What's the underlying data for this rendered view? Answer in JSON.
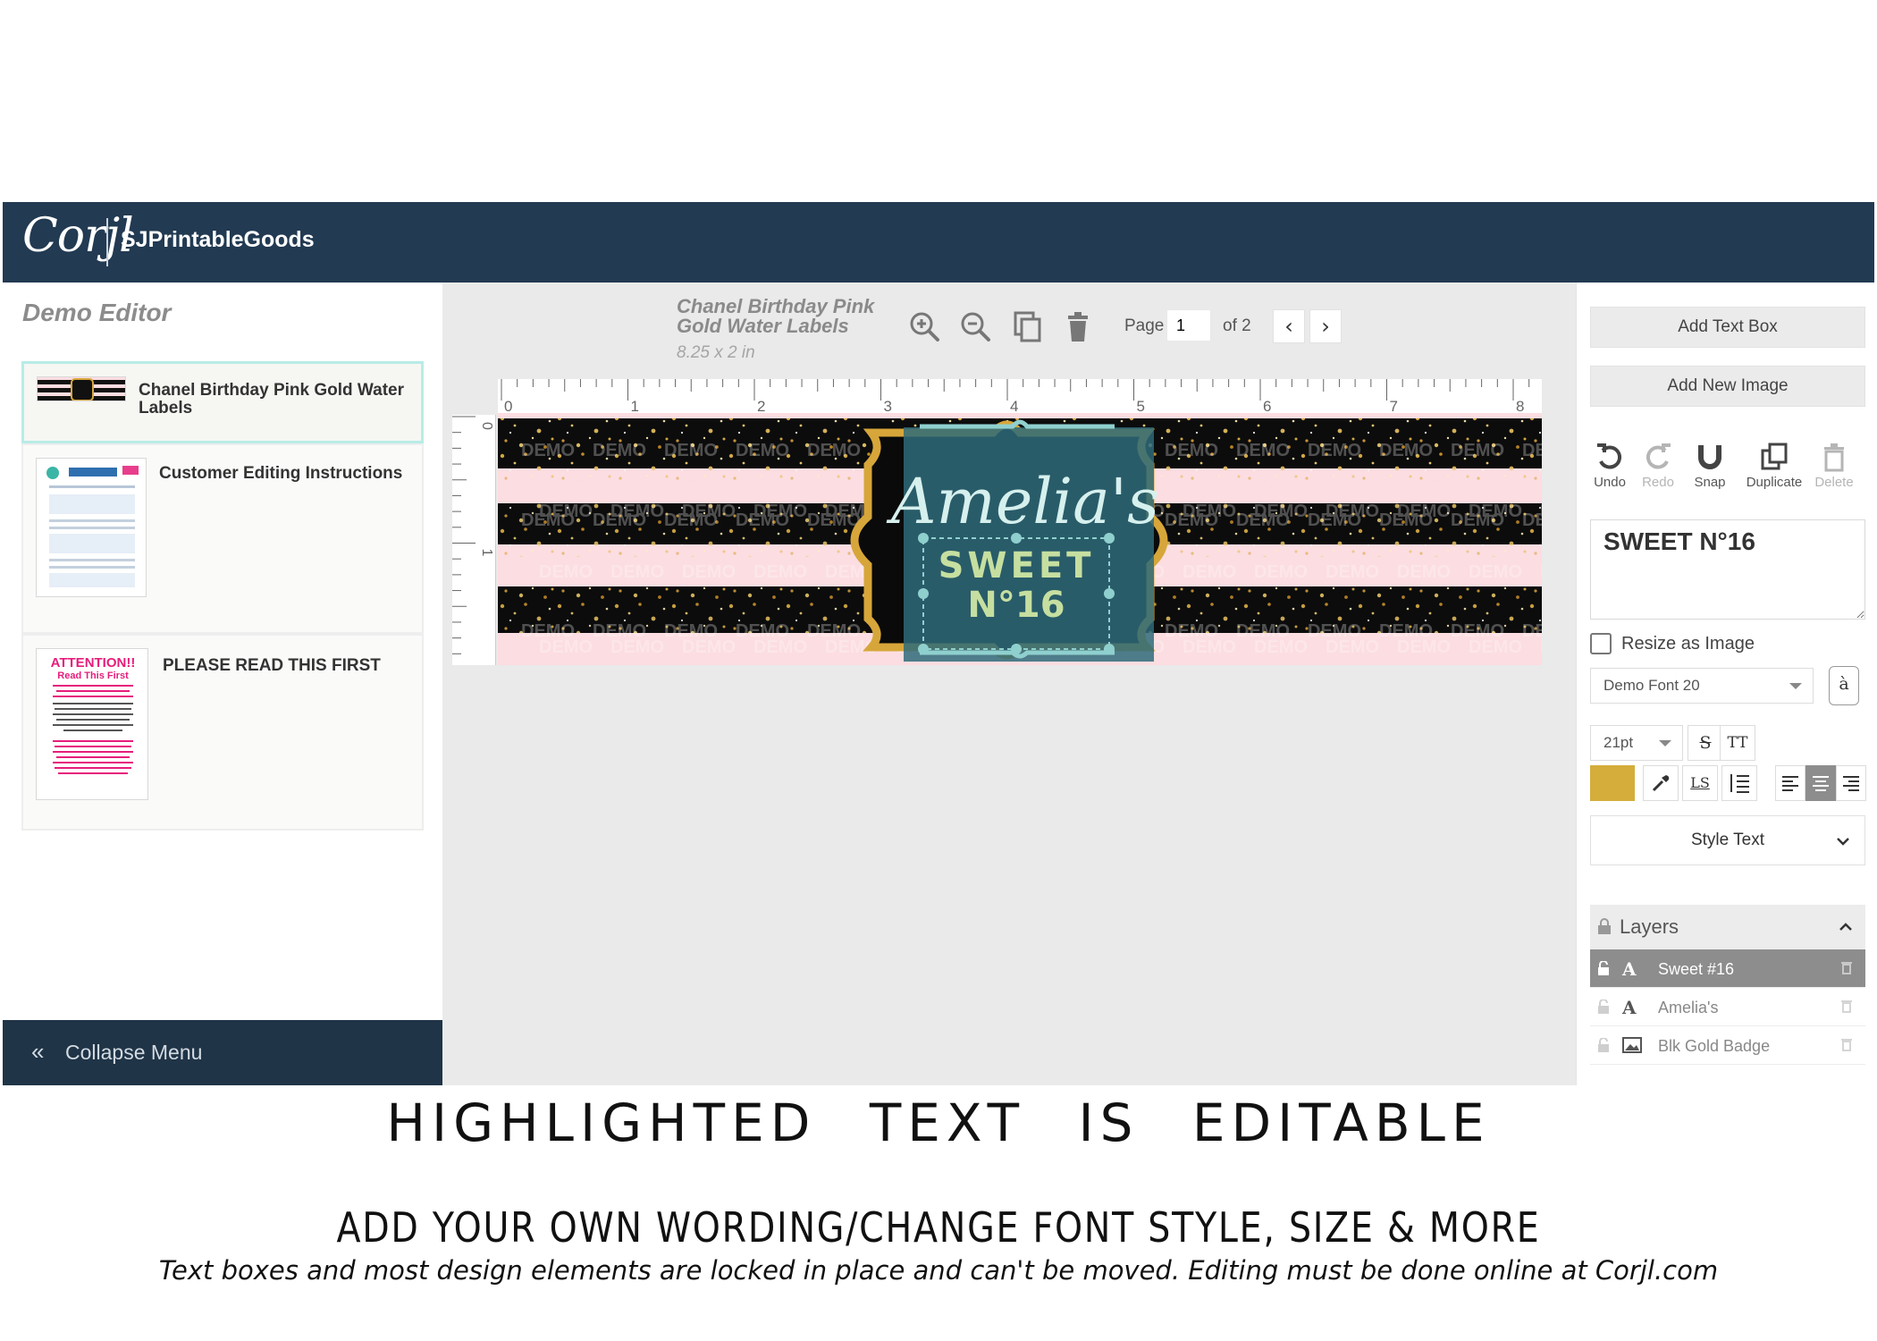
{
  "header": {
    "logo": "Corjl",
    "brand": "SJPrintableGoods"
  },
  "sidebar": {
    "title": "Demo Editor",
    "pages": [
      {
        "label": "Chanel Birthday Pink Gold Water Labels",
        "selected": true
      },
      {
        "label": "Customer Editing Instructions",
        "selected": false
      },
      {
        "label": "PLEASE READ THIS FIRST",
        "selected": false
      }
    ],
    "collapse_label": "Collapse Menu"
  },
  "toolbar": {
    "doc_title": "Chanel Birthday Pink Gold Water Labels",
    "doc_size": "8.25 x 2 in",
    "page_label": "Page",
    "page_value": "1",
    "page_of": "of 2"
  },
  "ruler": {
    "h_ticks": [
      "0",
      "1",
      "2",
      "3",
      "4",
      "5",
      "6",
      "7",
      "8"
    ],
    "v_ticks": [
      "0",
      "1"
    ]
  },
  "design": {
    "name": "Amelia's",
    "sweet": "SWEET",
    "number": "N°16",
    "watermark": "DEMO",
    "colors": {
      "pink": "#fcdde1",
      "black": "#0c0c0c",
      "gold": "#d7a63a",
      "teal": "#2f6b7a",
      "sweet_text": "#c6dfa0"
    }
  },
  "right_panel": {
    "add_text_box": "Add Text Box",
    "add_new_image": "Add New Image",
    "actions": [
      {
        "label": "Undo",
        "icon": "undo-icon",
        "enabled": true
      },
      {
        "label": "Redo",
        "icon": "redo-icon",
        "enabled": false
      },
      {
        "label": "Snap",
        "icon": "magnet-icon",
        "enabled": true
      },
      {
        "label": "Duplicate",
        "icon": "duplicate-icon",
        "enabled": true
      },
      {
        "label": "Delete",
        "icon": "trash-icon",
        "enabled": false
      }
    ],
    "text_value": "SWEET N°16",
    "resize_label": "Resize as Image",
    "font": "Demo Font 20",
    "size": "21pt",
    "text_color": "#d4ad3b",
    "style_text": "Style Text",
    "layers_label": "Layers",
    "layers": [
      {
        "name": "Sweet #16",
        "type": "text",
        "active": true
      },
      {
        "name": "Amelia's",
        "type": "text",
        "active": false
      },
      {
        "name": "Blk Gold Badge",
        "type": "image",
        "active": false
      }
    ]
  },
  "captions": {
    "headline": "HIGHLIGHTED TEXT IS EDITABLE",
    "subline": "ADD YOUR OWN WORDING/CHANGE FONT STYLE, SIZE & MORE",
    "note": "Text boxes and most design elements are locked in place and can't be moved. Editing must be done online at Corjl.com"
  }
}
